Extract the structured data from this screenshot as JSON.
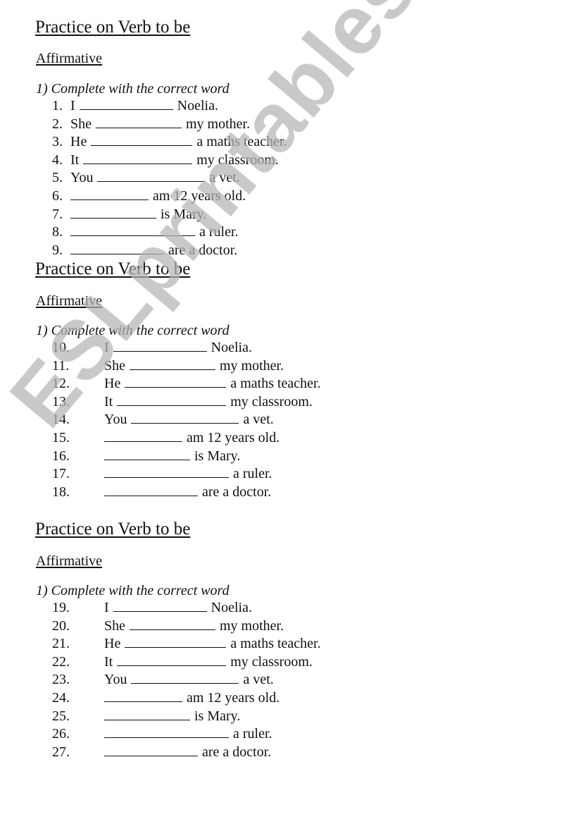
{
  "watermark": "ESLprintables.com",
  "sections": [
    {
      "title": "Practice on Verb to be",
      "subtitle": "Affirmative",
      "instruction": "1) Complete with the correct word",
      "items": [
        {
          "num": "1.",
          "before": "I",
          "after": "Noelia."
        },
        {
          "num": "2.",
          "before": "She",
          "after": "my mother."
        },
        {
          "num": "3.",
          "before": "He",
          "after": "a maths teacher."
        },
        {
          "num": "4.",
          "before": "It",
          "after": "my classroom."
        },
        {
          "num": "5.",
          "before": "You",
          "after": "a vet."
        },
        {
          "num": "6.",
          "before": "",
          "after": "am 12 years old."
        },
        {
          "num": "7.",
          "before": "",
          "after": "is Mary."
        },
        {
          "num": "8.",
          "before": "",
          "after": "a ruler."
        },
        {
          "num": "9.",
          "before": "",
          "after": "are a doctor."
        }
      ]
    },
    {
      "title": "Practice on Verb to be",
      "subtitle": "Affirmative",
      "instruction": "1) Complete with the correct word",
      "items": [
        {
          "num": "10.",
          "before": "I",
          "after": "Noelia."
        },
        {
          "num": "11.",
          "before": "She",
          "after": "my mother."
        },
        {
          "num": "12.",
          "before": "He",
          "after": "a maths teacher."
        },
        {
          "num": "13.",
          "before": "It",
          "after": "my classroom."
        },
        {
          "num": "14.",
          "before": "You",
          "after": "a vet."
        },
        {
          "num": "15.",
          "before": "",
          "after": "am 12 years old."
        },
        {
          "num": "16.",
          "before": "",
          "after": "is Mary."
        },
        {
          "num": "17.",
          "before": "",
          "after": "a ruler."
        },
        {
          "num": "18.",
          "before": "",
          "after": "are a doctor."
        }
      ]
    },
    {
      "title": "Practice on Verb to be",
      "subtitle": "Affirmative",
      "instruction": "1) Complete with the correct word",
      "items": [
        {
          "num": "19.",
          "before": "I",
          "after": "Noelia."
        },
        {
          "num": "20.",
          "before": "She",
          "after": "my mother."
        },
        {
          "num": "21.",
          "before": "He",
          "after": "a maths teacher."
        },
        {
          "num": "22.",
          "before": "It",
          "after": "my classroom."
        },
        {
          "num": "23.",
          "before": "You",
          "after": "a vet."
        },
        {
          "num": "24.",
          "before": "",
          "after": "am 12 years old."
        },
        {
          "num": "25.",
          "before": "",
          "after": "is Mary."
        },
        {
          "num": "26.",
          "before": "",
          "after": "a ruler."
        },
        {
          "num": "27.",
          "before": "",
          "after": "are a doctor."
        }
      ]
    }
  ]
}
